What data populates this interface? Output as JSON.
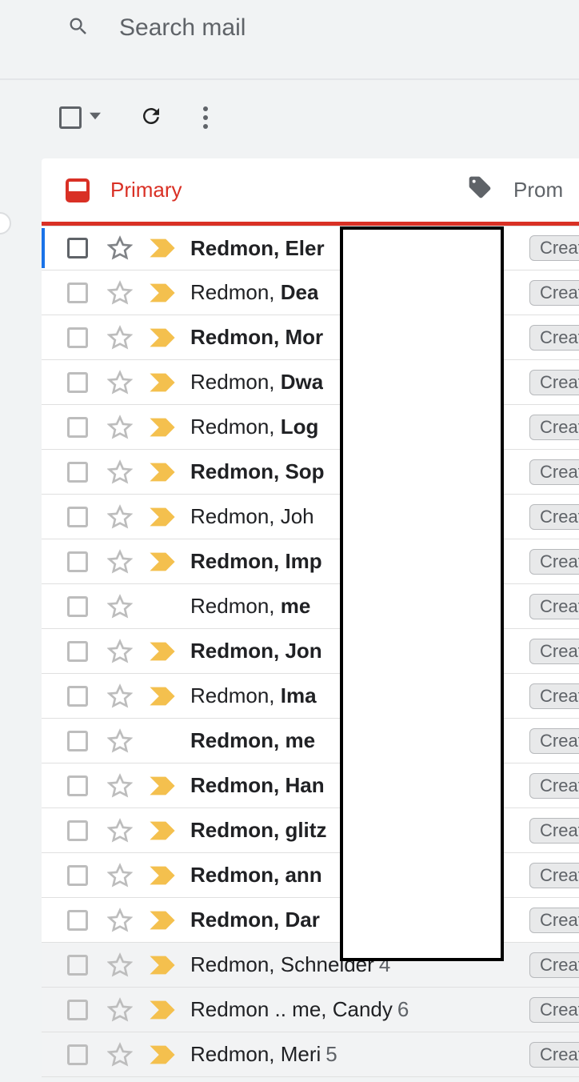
{
  "search": {
    "placeholder": "Search mail"
  },
  "tabs": {
    "primary": "Primary",
    "promotions": "Prom"
  },
  "chip_label": "Creat",
  "rows": [
    {
      "pre": "Redmon",
      "post": "Eler",
      "has_important": true,
      "unread": true,
      "read": false,
      "allbold": false,
      "count": ""
    },
    {
      "pre": "Redmon, ",
      "post": "Dea",
      "has_important": true,
      "unread": false,
      "read": false,
      "allbold": false,
      "count": ""
    },
    {
      "pre": "Redmon",
      "post": "Mor",
      "has_important": true,
      "unread": true,
      "read": false,
      "allbold": false,
      "count": ""
    },
    {
      "pre": "Redmon, ",
      "post": "Dwa",
      "has_important": true,
      "unread": false,
      "read": false,
      "allbold": false,
      "count": ""
    },
    {
      "pre": "Redmon, ",
      "post": "Log",
      "has_important": true,
      "unread": false,
      "read": false,
      "allbold": false,
      "count": ""
    },
    {
      "pre": "Redmon",
      "post": "Sop",
      "has_important": true,
      "unread": true,
      "read": false,
      "allbold": false,
      "count": ""
    },
    {
      "pre": "Redmon, Joh",
      "post": "",
      "has_important": true,
      "unread": false,
      "read": false,
      "allbold": false,
      "count": ""
    },
    {
      "pre": "Redmon",
      "post": "Imp",
      "has_important": true,
      "unread": true,
      "read": false,
      "allbold": false,
      "count": ""
    },
    {
      "pre": "Redmon, ",
      "post": "me",
      "has_important": false,
      "unread": false,
      "read": false,
      "allbold": false,
      "count": ""
    },
    {
      "pre": "Redmon",
      "post": "Jon",
      "has_important": true,
      "unread": true,
      "read": false,
      "allbold": false,
      "count": ""
    },
    {
      "pre": "Redmon, ",
      "post": "Ima",
      "has_important": true,
      "unread": false,
      "read": false,
      "allbold": false,
      "count": ""
    },
    {
      "pre": "Redmon, me",
      "post": "",
      "has_important": false,
      "unread": false,
      "read": false,
      "allbold": true,
      "count": ""
    },
    {
      "pre": "Redmon",
      "post": "Han",
      "has_important": true,
      "unread": true,
      "read": false,
      "allbold": false,
      "count": ""
    },
    {
      "pre": "Redmon",
      "post": "glitz",
      "has_important": true,
      "unread": true,
      "read": false,
      "allbold": false,
      "count": ""
    },
    {
      "pre": "Redmon",
      "post": "ann",
      "has_important": true,
      "unread": true,
      "read": false,
      "allbold": false,
      "count": ""
    },
    {
      "pre": "Redmon",
      "post": "Dar",
      "has_important": true,
      "unread": true,
      "read": false,
      "allbold": false,
      "count": ""
    },
    {
      "pre": "Redmon, Schneider",
      "post": "",
      "has_important": true,
      "unread": false,
      "read": true,
      "allbold": false,
      "count": "4"
    },
    {
      "pre": "Redmon .. me, Candy",
      "post": "",
      "has_important": true,
      "unread": false,
      "read": true,
      "allbold": false,
      "count": "6"
    },
    {
      "pre": "Redmon, Meri",
      "post": "",
      "has_important": true,
      "unread": false,
      "read": true,
      "allbold": false,
      "count": "5"
    }
  ]
}
